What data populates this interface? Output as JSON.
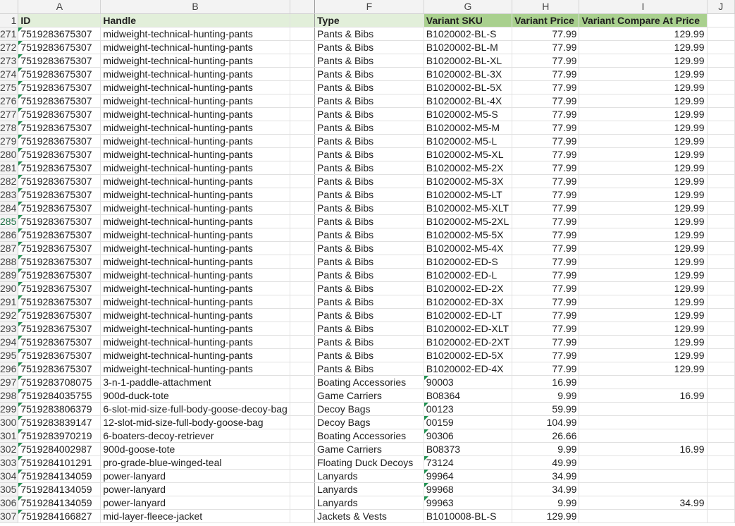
{
  "columns": [
    "A",
    "B",
    "",
    "F",
    "G",
    "H",
    "I",
    "J"
  ],
  "header_row": {
    "num": "1",
    "cells": [
      "ID",
      "Handle",
      "",
      "Type",
      "Variant SKU",
      "Variant Price",
      "Variant Compare At Price",
      ""
    ]
  },
  "selected_row": "285",
  "rows": [
    {
      "n": "271",
      "id": "7519283675307",
      "handle": "midweight-technical-hunting-pants",
      "type": "Pants & Bibs",
      "sku": "B1020002-BL-S",
      "price": "77.99",
      "compare": "129.99"
    },
    {
      "n": "272",
      "id": "7519283675307",
      "handle": "midweight-technical-hunting-pants",
      "type": "Pants & Bibs",
      "sku": "B1020002-BL-M",
      "price": "77.99",
      "compare": "129.99"
    },
    {
      "n": "273",
      "id": "7519283675307",
      "handle": "midweight-technical-hunting-pants",
      "type": "Pants & Bibs",
      "sku": "B1020002-BL-XL",
      "price": "77.99",
      "compare": "129.99"
    },
    {
      "n": "274",
      "id": "7519283675307",
      "handle": "midweight-technical-hunting-pants",
      "type": "Pants & Bibs",
      "sku": "B1020002-BL-3X",
      "price": "77.99",
      "compare": "129.99"
    },
    {
      "n": "275",
      "id": "7519283675307",
      "handle": "midweight-technical-hunting-pants",
      "type": "Pants & Bibs",
      "sku": "B1020002-BL-5X",
      "price": "77.99",
      "compare": "129.99"
    },
    {
      "n": "276",
      "id": "7519283675307",
      "handle": "midweight-technical-hunting-pants",
      "type": "Pants & Bibs",
      "sku": "B1020002-BL-4X",
      "price": "77.99",
      "compare": "129.99"
    },
    {
      "n": "277",
      "id": "7519283675307",
      "handle": "midweight-technical-hunting-pants",
      "type": "Pants & Bibs",
      "sku": "B1020002-M5-S",
      "price": "77.99",
      "compare": "129.99"
    },
    {
      "n": "278",
      "id": "7519283675307",
      "handle": "midweight-technical-hunting-pants",
      "type": "Pants & Bibs",
      "sku": "B1020002-M5-M",
      "price": "77.99",
      "compare": "129.99"
    },
    {
      "n": "279",
      "id": "7519283675307",
      "handle": "midweight-technical-hunting-pants",
      "type": "Pants & Bibs",
      "sku": "B1020002-M5-L",
      "price": "77.99",
      "compare": "129.99"
    },
    {
      "n": "280",
      "id": "7519283675307",
      "handle": "midweight-technical-hunting-pants",
      "type": "Pants & Bibs",
      "sku": "B1020002-M5-XL",
      "price": "77.99",
      "compare": "129.99"
    },
    {
      "n": "281",
      "id": "7519283675307",
      "handle": "midweight-technical-hunting-pants",
      "type": "Pants & Bibs",
      "sku": "B1020002-M5-2X",
      "price": "77.99",
      "compare": "129.99"
    },
    {
      "n": "282",
      "id": "7519283675307",
      "handle": "midweight-technical-hunting-pants",
      "type": "Pants & Bibs",
      "sku": "B1020002-M5-3X",
      "price": "77.99",
      "compare": "129.99"
    },
    {
      "n": "283",
      "id": "7519283675307",
      "handle": "midweight-technical-hunting-pants",
      "type": "Pants & Bibs",
      "sku": "B1020002-M5-LT",
      "price": "77.99",
      "compare": "129.99"
    },
    {
      "n": "284",
      "id": "7519283675307",
      "handle": "midweight-technical-hunting-pants",
      "type": "Pants & Bibs",
      "sku": "B1020002-M5-XLT",
      "price": "77.99",
      "compare": "129.99"
    },
    {
      "n": "285",
      "id": "7519283675307",
      "handle": "midweight-technical-hunting-pants",
      "type": "Pants & Bibs",
      "sku": "B1020002-M5-2XL",
      "price": "77.99",
      "compare": "129.99"
    },
    {
      "n": "286",
      "id": "7519283675307",
      "handle": "midweight-technical-hunting-pants",
      "type": "Pants & Bibs",
      "sku": "B1020002-M5-5X",
      "price": "77.99",
      "compare": "129.99"
    },
    {
      "n": "287",
      "id": "7519283675307",
      "handle": "midweight-technical-hunting-pants",
      "type": "Pants & Bibs",
      "sku": "B1020002-M5-4X",
      "price": "77.99",
      "compare": "129.99"
    },
    {
      "n": "288",
      "id": "7519283675307",
      "handle": "midweight-technical-hunting-pants",
      "type": "Pants & Bibs",
      "sku": "B1020002-ED-S",
      "price": "77.99",
      "compare": "129.99"
    },
    {
      "n": "289",
      "id": "7519283675307",
      "handle": "midweight-technical-hunting-pants",
      "type": "Pants & Bibs",
      "sku": "B1020002-ED-L",
      "price": "77.99",
      "compare": "129.99"
    },
    {
      "n": "290",
      "id": "7519283675307",
      "handle": "midweight-technical-hunting-pants",
      "type": "Pants & Bibs",
      "sku": "B1020002-ED-2X",
      "price": "77.99",
      "compare": "129.99"
    },
    {
      "n": "291",
      "id": "7519283675307",
      "handle": "midweight-technical-hunting-pants",
      "type": "Pants & Bibs",
      "sku": "B1020002-ED-3X",
      "price": "77.99",
      "compare": "129.99"
    },
    {
      "n": "292",
      "id": "7519283675307",
      "handle": "midweight-technical-hunting-pants",
      "type": "Pants & Bibs",
      "sku": "B1020002-ED-LT",
      "price": "77.99",
      "compare": "129.99"
    },
    {
      "n": "293",
      "id": "7519283675307",
      "handle": "midweight-technical-hunting-pants",
      "type": "Pants & Bibs",
      "sku": "B1020002-ED-XLT",
      "price": "77.99",
      "compare": "129.99"
    },
    {
      "n": "294",
      "id": "7519283675307",
      "handle": "midweight-technical-hunting-pants",
      "type": "Pants & Bibs",
      "sku": "B1020002-ED-2XT",
      "price": "77.99",
      "compare": "129.99"
    },
    {
      "n": "295",
      "id": "7519283675307",
      "handle": "midweight-technical-hunting-pants",
      "type": "Pants & Bibs",
      "sku": "B1020002-ED-5X",
      "price": "77.99",
      "compare": "129.99"
    },
    {
      "n": "296",
      "id": "7519283675307",
      "handle": "midweight-technical-hunting-pants",
      "type": "Pants & Bibs",
      "sku": "B1020002-ED-4X",
      "price": "77.99",
      "compare": "129.99"
    },
    {
      "n": "297",
      "id": "7519283708075",
      "handle": "3-n-1-paddle-attachment",
      "type": "Boating Accessories",
      "sku": "90003",
      "skuText": true,
      "price": "16.99",
      "compare": ""
    },
    {
      "n": "298",
      "id": "7519284035755",
      "handle": "900d-duck-tote",
      "type": "Game Carriers",
      "sku": "B08364",
      "price": "9.99",
      "compare": "16.99"
    },
    {
      "n": "299",
      "id": "7519283806379",
      "handle": "6-slot-mid-size-full-body-goose-decoy-bag",
      "type": "Decoy Bags",
      "sku": "00123",
      "skuText": true,
      "price": "59.99",
      "compare": ""
    },
    {
      "n": "300",
      "id": "7519283839147",
      "handle": "12-slot-mid-size-full-body-goose-bag",
      "type": "Decoy Bags",
      "sku": "00159",
      "skuText": true,
      "price": "104.99",
      "compare": ""
    },
    {
      "n": "301",
      "id": "7519283970219",
      "handle": "6-boaters-decoy-retriever",
      "type": "Boating Accessories",
      "sku": "90306",
      "skuText": true,
      "price": "26.66",
      "compare": ""
    },
    {
      "n": "302",
      "id": "7519284002987",
      "handle": "900d-goose-tote",
      "type": "Game Carriers",
      "sku": "B08373",
      "price": "9.99",
      "compare": "16.99"
    },
    {
      "n": "303",
      "id": "7519284101291",
      "handle": "pro-grade-blue-winged-teal",
      "type": "Floating Duck Decoys",
      "sku": "73124",
      "skuText": true,
      "price": "49.99",
      "compare": ""
    },
    {
      "n": "304",
      "id": "7519284134059",
      "handle": "power-lanyard",
      "type": "Lanyards",
      "sku": "99964",
      "skuText": true,
      "price": "34.99",
      "compare": ""
    },
    {
      "n": "305",
      "id": "7519284134059",
      "handle": "power-lanyard",
      "type": "Lanyards",
      "sku": "99968",
      "skuText": true,
      "price": "34.99",
      "compare": ""
    },
    {
      "n": "306",
      "id": "7519284134059",
      "handle": "power-lanyard",
      "type": "Lanyards",
      "sku": "99963",
      "skuText": true,
      "price": "9.99",
      "compare": "34.99"
    },
    {
      "n": "307",
      "id": "7519284166827",
      "handle": "mid-layer-fleece-jacket",
      "type": "Jackets & Vests",
      "sku": "B1010008-BL-S",
      "price": "129.99",
      "compare": ""
    }
  ]
}
